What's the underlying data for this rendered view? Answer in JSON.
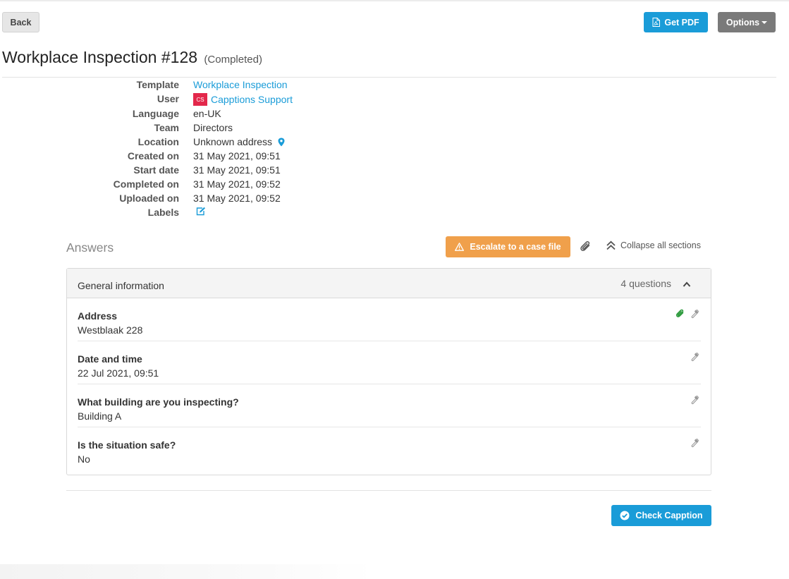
{
  "toolbar": {
    "back_label": "Back",
    "pdf_label": "Get PDF",
    "options_label": "Options"
  },
  "header": {
    "title": "Workplace Inspection #128",
    "status": "(Completed)"
  },
  "meta": {
    "template": {
      "label": "Template",
      "value": "Workplace Inspection"
    },
    "user": {
      "label": "User",
      "avatar": "CS",
      "value": "Capptions Support"
    },
    "language": {
      "label": "Language",
      "value": "en-UK"
    },
    "team": {
      "label": "Team",
      "value": "Directors"
    },
    "location": {
      "label": "Location",
      "value": "Unknown address"
    },
    "created_on": {
      "label": "Created on",
      "value": "31 May 2021, 09:51"
    },
    "start_date": {
      "label": "Start date",
      "value": "31 May 2021, 09:51"
    },
    "completed_on": {
      "label": "Completed on",
      "value": "31 May 2021, 09:52"
    },
    "uploaded_on": {
      "label": "Uploaded on",
      "value": "31 May 2021, 09:52"
    },
    "labels": {
      "label": "Labels"
    }
  },
  "answers": {
    "title": "Answers",
    "escalate_label": "Escalate to a case file",
    "collapse_all_label": "Collapse all sections",
    "section": {
      "title": "General information",
      "count": "4 questions",
      "questions": [
        {
          "label": "Address",
          "value": "Westblaak 228",
          "has_attachment": true
        },
        {
          "label": "Date and time",
          "value": "22 Jul 2021, 09:51",
          "has_attachment": false
        },
        {
          "label": "What building are you inspecting?",
          "value": "Building A",
          "has_attachment": false
        },
        {
          "label": "Is the situation safe?",
          "value": "No",
          "has_attachment": false
        }
      ]
    }
  },
  "footer": {
    "check_label": "Check Capption"
  },
  "colors": {
    "primary": "#1a9cd8",
    "warning": "#f0a04b",
    "secondary": "#7a7a7a",
    "avatar": "#e3284b",
    "attachment": "#2e9b3e"
  }
}
